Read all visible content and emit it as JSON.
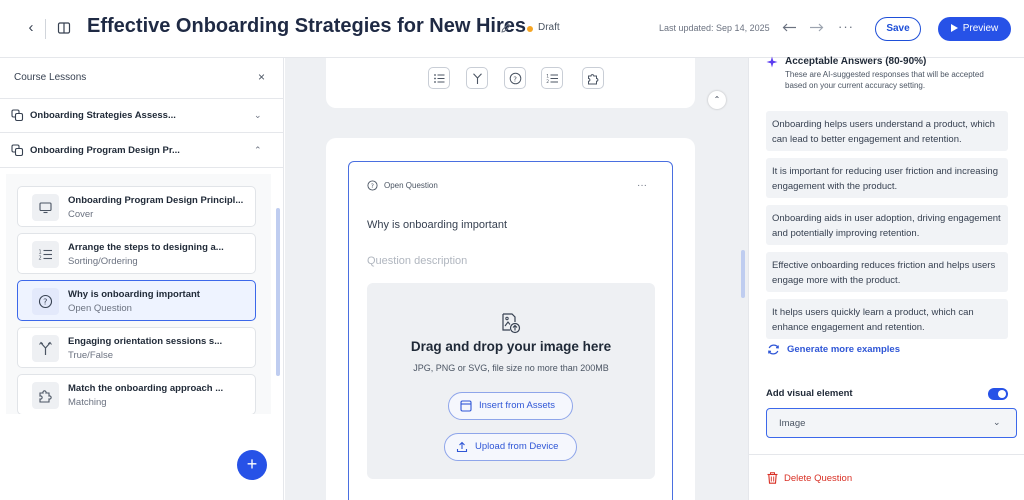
{
  "header": {
    "title": "Effective Onboarding Strategies for New Hires",
    "status": "Draft",
    "last_updated": "Last updated: Sep 14, 2025",
    "more": "···",
    "save_label": "Save",
    "preview_label": "Preview",
    "colors": {
      "accent": "#2752e7",
      "draft_dot": "#f5a524"
    }
  },
  "sidebar": {
    "title": "Course Lessons",
    "close": "×",
    "sections": [
      {
        "label": "Onboarding Strategies Assess...",
        "expanded": false,
        "chevron": "⌄"
      },
      {
        "label": "Onboarding Program Design Pr...",
        "expanded": true,
        "chevron": "⌃"
      }
    ],
    "lessons": [
      {
        "title": "Onboarding Program Design Principl...",
        "type": "Cover",
        "icon": "monitor-icon"
      },
      {
        "title": "Arrange the steps to designing a...",
        "type": "Sorting/Ordering",
        "icon": "sort-list-icon"
      },
      {
        "title": "Why is onboarding important",
        "type": "Open Question",
        "icon": "question-circle-icon",
        "active": true
      },
      {
        "title": "Engaging orientation sessions s...",
        "type": "True/False",
        "icon": "branch-icon"
      },
      {
        "title": "Match the onboarding approach ...",
        "type": "Matching",
        "icon": "puzzle-icon"
      }
    ],
    "add_button": "+"
  },
  "canvas": {
    "toolbar": [
      "list-icon",
      "branch-icon",
      "question-circle-icon",
      "sort-list-icon",
      "puzzle-icon"
    ],
    "collapse": "⌃",
    "question": {
      "type_label": "Open Question",
      "more": "···",
      "text": "Why is onboarding important",
      "description_placeholder": "Question description"
    },
    "dropzone": {
      "title": "Drag and drop your image here",
      "subtitle": "JPG, PNG or SVG, file size no more than 200MB",
      "insert_label": "Insert from Assets",
      "upload_label": "Upload from Device"
    }
  },
  "right_panel": {
    "acceptable_title": "Acceptable Answers (80-90%)",
    "acceptable_desc": "These are AI-suggested responses that will be accepted based on your current accuracy setting.",
    "answers": [
      "Onboarding helps users understand a product, which can lead to better engagement and retention.",
      "It is important for reducing user friction and increasing engagement with the product.",
      "Onboarding aids in user adoption, driving engagement and potentially improving retention.",
      "Effective onboarding reduces friction and helps users engage more with the product.",
      "It helps users quickly learn a product, which can enhance engagement and retention."
    ],
    "generate_label": "Generate more examples",
    "visual_label": "Add visual element",
    "visual_enabled": true,
    "visual_value": "Image",
    "select_chevron": "⌄",
    "delete_label": "Delete Question",
    "colors": {
      "danger": "#d93025",
      "link": "#2f56d6"
    }
  }
}
